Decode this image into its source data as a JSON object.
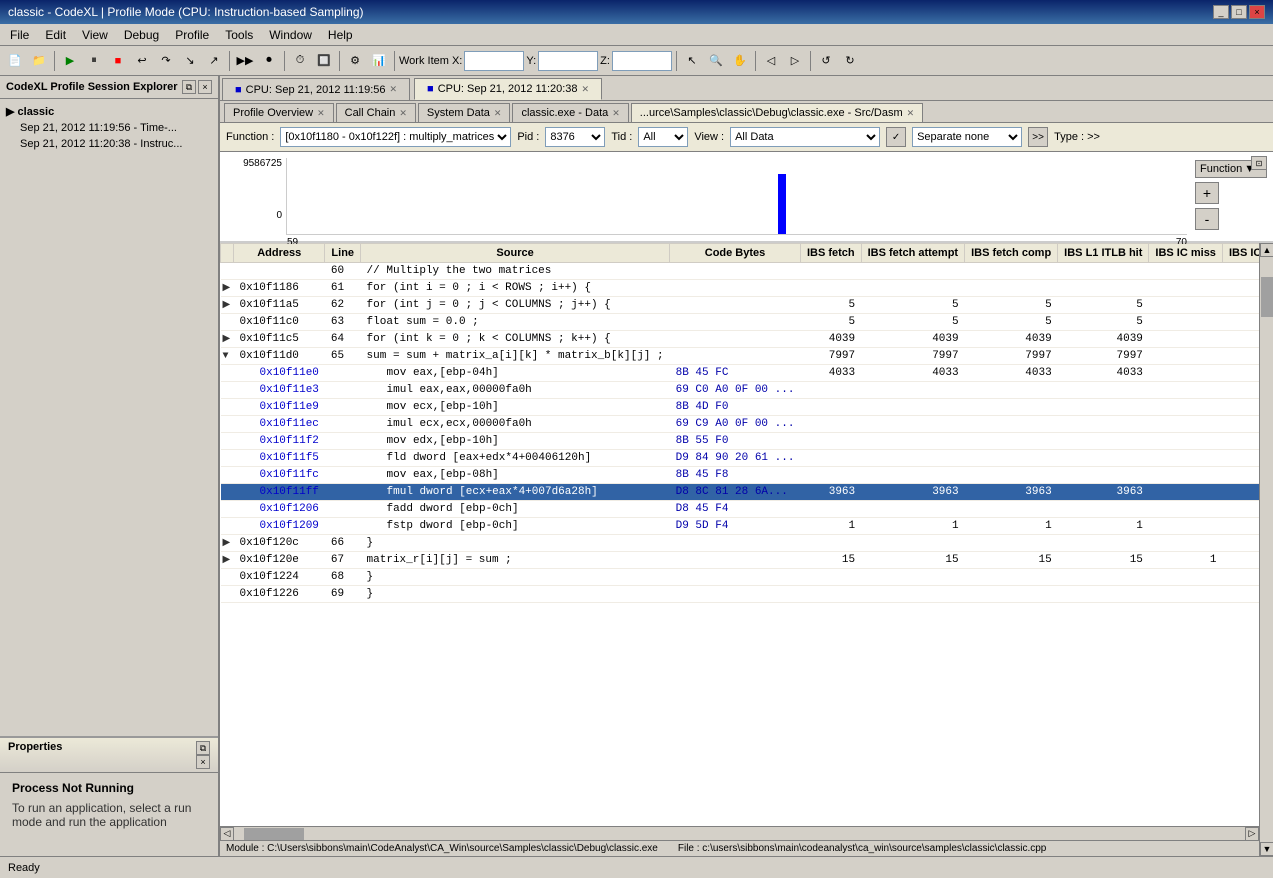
{
  "window": {
    "title": "classic - CodeXL | Profile Mode (CPU: Instruction-based Sampling)"
  },
  "titlebar": {
    "controls": [
      "_",
      "□",
      "×"
    ]
  },
  "menubar": {
    "items": [
      "File",
      "Edit",
      "View",
      "Debug",
      "Profile",
      "Tools",
      "Window",
      "Help"
    ]
  },
  "toolbar": {
    "workitem_label": "Work Item X:",
    "workitem_x": "",
    "workitem_y_label": "Y:",
    "workitem_y": "",
    "workitem_z_label": "Z:",
    "workitem_z": ""
  },
  "sidebar": {
    "title": "CodeXL Profile Session Explorer",
    "items": [
      {
        "label": "classic",
        "level": 0
      },
      {
        "label": "Sep 21, 2012 11:19:56 - Time-...",
        "level": 1
      },
      {
        "label": "Sep 21, 2012 11:20:38 - Instruc...",
        "level": 1
      }
    ]
  },
  "cpu_sessions": [
    {
      "label": "CPU: Sep 21, 2012 11:19:56",
      "active": false
    },
    {
      "label": "CPU: Sep 21, 2012 11:20:38",
      "active": true
    }
  ],
  "tabs": [
    {
      "label": "Profile Overview",
      "active": false
    },
    {
      "label": "Call Chain",
      "active": false
    },
    {
      "label": "System Data",
      "active": false
    },
    {
      "label": "classic.exe - Data",
      "active": false
    },
    {
      "label": "...urce\\Samples\\classic\\Debug\\classic.exe - Src/Dasm",
      "active": true
    }
  ],
  "function_bar": {
    "function_label": "Function :",
    "function_value": "[0x10f1180 - 0x10f122f] : multiply_matrices",
    "pid_label": "Pid :",
    "pid_value": "8376",
    "tid_label": "Tid :",
    "tid_value": "All",
    "view_label": "View :",
    "view_value": "All Data",
    "separate_label": "Separate none",
    "type_label": "Type : >>"
  },
  "chart": {
    "y_max": "9586725",
    "y_min": "0",
    "x_start": "59",
    "x_end": "70",
    "dropdown_label": "Function",
    "plus_btn": "+",
    "minus_btn": "-"
  },
  "table": {
    "columns": [
      "Address",
      "Line",
      "Source",
      "Code Bytes",
      "IBS fetch",
      "IBS fetch attempt",
      "IBS fetch comp",
      "IBS L1 ITLB hit",
      "IBS IC miss",
      "IBS IC h"
    ],
    "rows": [
      {
        "expand": "",
        "addr": "",
        "line": "60",
        "source": "// Multiply the two matrices",
        "bytes": "",
        "ibs_fetch": "",
        "ibs_fetch_att": "",
        "ibs_fetch_comp": "",
        "ibs_l1": "",
        "ibs_ic_miss": "",
        "indent": 0,
        "selected": false
      },
      {
        "expand": "▶",
        "addr": "0x10f1186",
        "line": "61",
        "source": "for (int i = 0 ; i < ROWS ; i++) {",
        "bytes": "",
        "ibs_fetch": "",
        "ibs_fetch_att": "",
        "ibs_fetch_comp": "",
        "ibs_l1": "",
        "ibs_ic_miss": "",
        "indent": 0,
        "selected": false
      },
      {
        "expand": "▶",
        "addr": "0x10f11a5",
        "line": "62",
        "source": "for (int j = 0 ; j < COLUMNS ; j++) {",
        "bytes": "",
        "ibs_fetch": "5",
        "ibs_fetch_att": "5",
        "ibs_fetch_comp": "5",
        "ibs_l1": "5",
        "ibs_ic_miss": "",
        "indent": 0,
        "selected": false
      },
      {
        "expand": "",
        "addr": "0x10f11c0",
        "line": "63",
        "source": "float sum = 0.0 ;",
        "bytes": "",
        "ibs_fetch": "5",
        "ibs_fetch_att": "5",
        "ibs_fetch_comp": "5",
        "ibs_l1": "5",
        "ibs_ic_miss": "",
        "indent": 0,
        "selected": false
      },
      {
        "expand": "▶",
        "addr": "0x10f11c5",
        "line": "64",
        "source": "for (int k = 0 ; k < COLUMNS ; k++) {",
        "bytes": "",
        "ibs_fetch": "4039",
        "ibs_fetch_att": "4039",
        "ibs_fetch_comp": "4039",
        "ibs_l1": "4039",
        "ibs_ic_miss": "",
        "indent": 0,
        "selected": false
      },
      {
        "expand": "▼",
        "addr": "0x10f11d0",
        "line": "65",
        "source": "sum = sum + matrix_a[i][k] * matrix_b[k][j] ;",
        "bytes": "",
        "ibs_fetch": "7997",
        "ibs_fetch_att": "7997",
        "ibs_fetch_comp": "7997",
        "ibs_l1": "7997",
        "ibs_ic_miss": "",
        "indent": 0,
        "selected": false
      },
      {
        "expand": "",
        "addr": "0x10f11e0",
        "line": "",
        "source": "mov eax,[ebp-04h]",
        "bytes": "8B 45 FC",
        "ibs_fetch": "4033",
        "ibs_fetch_att": "4033",
        "ibs_fetch_comp": "4033",
        "ibs_l1": "4033",
        "ibs_ic_miss": "",
        "indent": 1,
        "hex": true,
        "selected": false
      },
      {
        "expand": "",
        "addr": "0x10f11e3",
        "line": "",
        "source": "imul eax,eax,00000fa0h",
        "bytes": "69 C0 A0 0F 00 ...",
        "ibs_fetch": "",
        "ibs_fetch_att": "",
        "ibs_fetch_comp": "",
        "ibs_l1": "",
        "ibs_ic_miss": "",
        "indent": 1,
        "hex": true,
        "selected": false
      },
      {
        "expand": "",
        "addr": "0x10f11e9",
        "line": "",
        "source": "mov ecx,[ebp-10h]",
        "bytes": "8B 4D F0",
        "ibs_fetch": "",
        "ibs_fetch_att": "",
        "ibs_fetch_comp": "",
        "ibs_l1": "",
        "ibs_ic_miss": "",
        "indent": 1,
        "hex": true,
        "selected": false
      },
      {
        "expand": "",
        "addr": "0x10f11ec",
        "line": "",
        "source": "imul ecx,ecx,00000fa0h",
        "bytes": "69 C9 A0 0F 00 ...",
        "ibs_fetch": "",
        "ibs_fetch_att": "",
        "ibs_fetch_comp": "",
        "ibs_l1": "",
        "ibs_ic_miss": "",
        "indent": 1,
        "hex": true,
        "selected": false
      },
      {
        "expand": "",
        "addr": "0x10f11f2",
        "line": "",
        "source": "mov edx,[ebp-10h]",
        "bytes": "8B 55 F0",
        "ibs_fetch": "",
        "ibs_fetch_att": "",
        "ibs_fetch_comp": "",
        "ibs_l1": "",
        "ibs_ic_miss": "",
        "indent": 1,
        "hex": true,
        "selected": false
      },
      {
        "expand": "",
        "addr": "0x10f11f5",
        "line": "",
        "source": "fld dword [eax+edx*4+00406120h]",
        "bytes": "D9 84 90 20 61 ...",
        "ibs_fetch": "",
        "ibs_fetch_att": "",
        "ibs_fetch_comp": "",
        "ibs_l1": "",
        "ibs_ic_miss": "",
        "indent": 1,
        "hex": true,
        "selected": false
      },
      {
        "expand": "",
        "addr": "0x10f11fc",
        "line": "",
        "source": "mov eax,[ebp-08h]",
        "bytes": "8B 45 F8",
        "ibs_fetch": "",
        "ibs_fetch_att": "",
        "ibs_fetch_comp": "",
        "ibs_l1": "",
        "ibs_ic_miss": "",
        "indent": 1,
        "hex": true,
        "selected": false
      },
      {
        "expand": "",
        "addr": "0x10f11ff",
        "line": "",
        "source": "fmul dword [ecx+eax*4+007d6a28h]",
        "bytes": "D8 8C 81 28 6A...",
        "ibs_fetch": "3963",
        "ibs_fetch_att": "3963",
        "ibs_fetch_comp": "3963",
        "ibs_l1": "3963",
        "ibs_ic_miss": "",
        "indent": 1,
        "hex": true,
        "selected": true
      },
      {
        "expand": "",
        "addr": "0x10f1206",
        "line": "",
        "source": "fadd dword [ebp-0ch]",
        "bytes": "D8 45 F4",
        "ibs_fetch": "",
        "ibs_fetch_att": "",
        "ibs_fetch_comp": "",
        "ibs_l1": "",
        "ibs_ic_miss": "",
        "indent": 1,
        "hex": true,
        "selected": false
      },
      {
        "expand": "",
        "addr": "0x10f1209",
        "line": "",
        "source": "fstp dword [ebp-0ch]",
        "bytes": "D9 5D F4",
        "ibs_fetch": "1",
        "ibs_fetch_att": "1",
        "ibs_fetch_comp": "1",
        "ibs_l1": "1",
        "ibs_ic_miss": "",
        "indent": 1,
        "hex": true,
        "selected": false
      },
      {
        "expand": "▶",
        "addr": "0x10f120c",
        "line": "66",
        "source": "}",
        "bytes": "",
        "ibs_fetch": "",
        "ibs_fetch_att": "",
        "ibs_fetch_comp": "",
        "ibs_l1": "",
        "ibs_ic_miss": "",
        "indent": 0,
        "selected": false
      },
      {
        "expand": "▶",
        "addr": "0x10f120e",
        "line": "67",
        "source": "matrix_r[i][j] = sum ;",
        "bytes": "",
        "ibs_fetch": "15",
        "ibs_fetch_att": "15",
        "ibs_fetch_comp": "15",
        "ibs_l1": "15",
        "ibs_ic_miss": "1",
        "indent": 0,
        "selected": false
      },
      {
        "expand": "",
        "addr": "0x10f1224",
        "line": "68",
        "source": "}",
        "bytes": "",
        "ibs_fetch": "",
        "ibs_fetch_att": "",
        "ibs_fetch_comp": "",
        "ibs_l1": "",
        "ibs_ic_miss": "",
        "indent": 0,
        "selected": false
      },
      {
        "expand": "",
        "addr": "0x10f1226",
        "line": "69",
        "source": "}",
        "bytes": "",
        "ibs_fetch": "",
        "ibs_fetch_att": "",
        "ibs_fetch_comp": "",
        "ibs_l1": "",
        "ibs_ic_miss": "",
        "indent": 0,
        "selected": false
      }
    ]
  },
  "module_bar": {
    "module": "Module : C:\\Users\\sibbons\\main\\CodeAnalyst\\CA_Win\\source\\Samples\\classic\\Debug\\classic.exe",
    "file": "File : c:\\users\\sibbons\\main\\codeanalyst\\ca_win\\source\\samples\\classic\\classic.cpp"
  },
  "properties": {
    "title": "Properties",
    "heading": "Process Not Running",
    "text": "To run an application, select a run mode and run the application"
  },
  "status": {
    "text": "Ready"
  }
}
